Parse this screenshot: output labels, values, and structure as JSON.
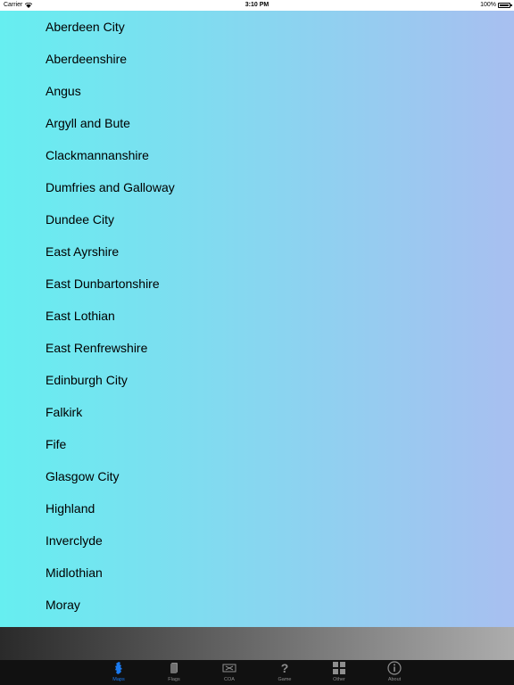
{
  "status_bar": {
    "carrier": "Carrier",
    "time": "3:10 PM",
    "battery": "100%"
  },
  "regions": [
    "Aberdeen City",
    "Aberdeenshire",
    "Angus",
    "Argyll and Bute",
    "Clackmannanshire",
    "Dumfries and Galloway",
    "Dundee City",
    "East Ayrshire",
    "East Dunbartonshire",
    "East Lothian",
    "East Renfrewshire",
    "Edinburgh City",
    "Falkirk",
    "Fife",
    "Glasgow City",
    "Highland",
    "Inverclyde",
    "Midlothian",
    "Moray"
  ],
  "tabs": [
    {
      "label": "Maps",
      "icon": "map-icon",
      "active": true
    },
    {
      "label": "Flags",
      "icon": "flag-icon",
      "active": false
    },
    {
      "label": "COA",
      "icon": "coat-of-arms-icon",
      "active": false
    },
    {
      "label": "Game",
      "icon": "question-icon",
      "active": false
    },
    {
      "label": "Other",
      "icon": "grid-icon",
      "active": false
    },
    {
      "label": "About",
      "icon": "info-icon",
      "active": false
    }
  ],
  "colors": {
    "gradient_start": "#66eef0",
    "gradient_end": "#a8bff0",
    "tab_active": "#1a7af0",
    "tab_inactive": "#8e8e8e",
    "tab_bar_bg": "#111111"
  }
}
